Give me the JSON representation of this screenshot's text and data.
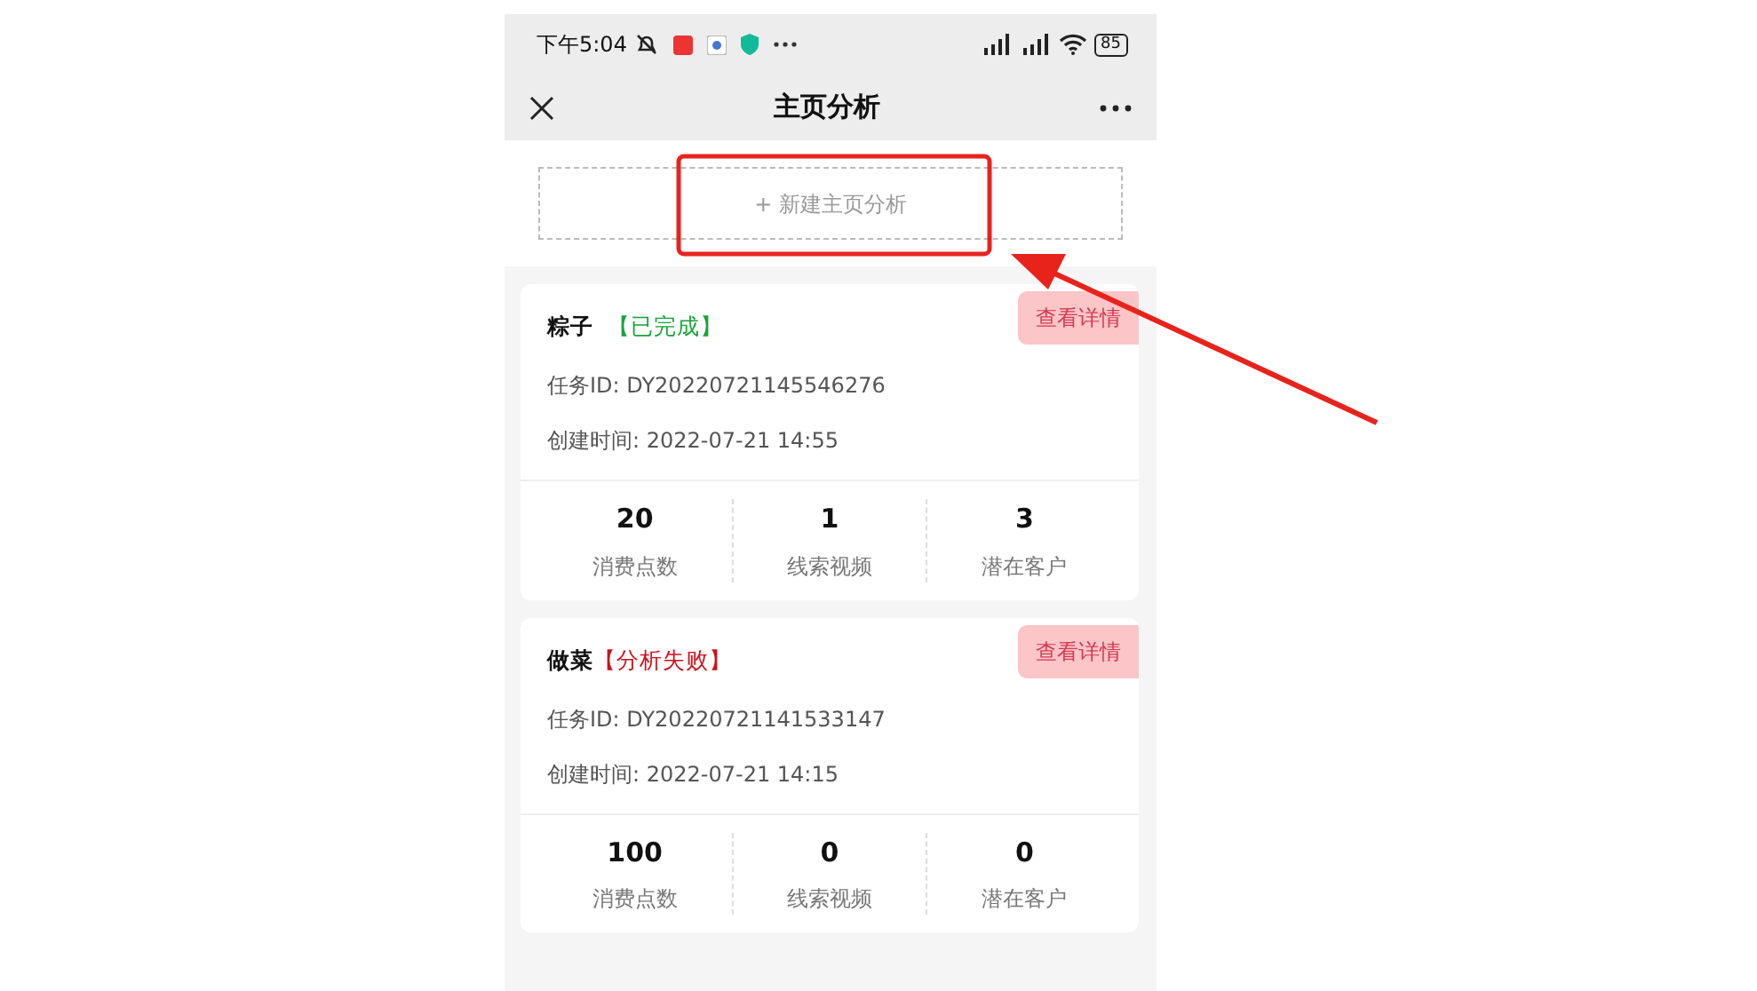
{
  "status_bar": {
    "time": "下午5:04",
    "battery": "85"
  },
  "nav": {
    "title": "主页分析"
  },
  "new_button": {
    "label": "+ 新建主页分析"
  },
  "tasks": [
    {
      "name": "粽子",
      "status": {
        "kind": "done",
        "label": "【已完成】"
      },
      "detail_button": "查看详情",
      "task_id": "任务ID: DY20220721145546276",
      "created": "创建时间: 2022-07-21 14:55",
      "stats": [
        {
          "value": "20",
          "label": "消费点数"
        },
        {
          "value": "1",
          "label": "线索视频"
        },
        {
          "value": "3",
          "label": "潜在客户"
        }
      ]
    },
    {
      "name": "做菜",
      "status": {
        "kind": "failed",
        "label": "【分析失败】"
      },
      "detail_button": "查看详情",
      "task_id": "任务ID: DY20220721141533147",
      "created": "创建时间: 2022-07-21 14:15",
      "stats": [
        {
          "value": "100",
          "label": "消费点数"
        },
        {
          "value": "0",
          "label": "线索视频"
        },
        {
          "value": "0",
          "label": "潜在客户"
        }
      ]
    }
  ]
}
